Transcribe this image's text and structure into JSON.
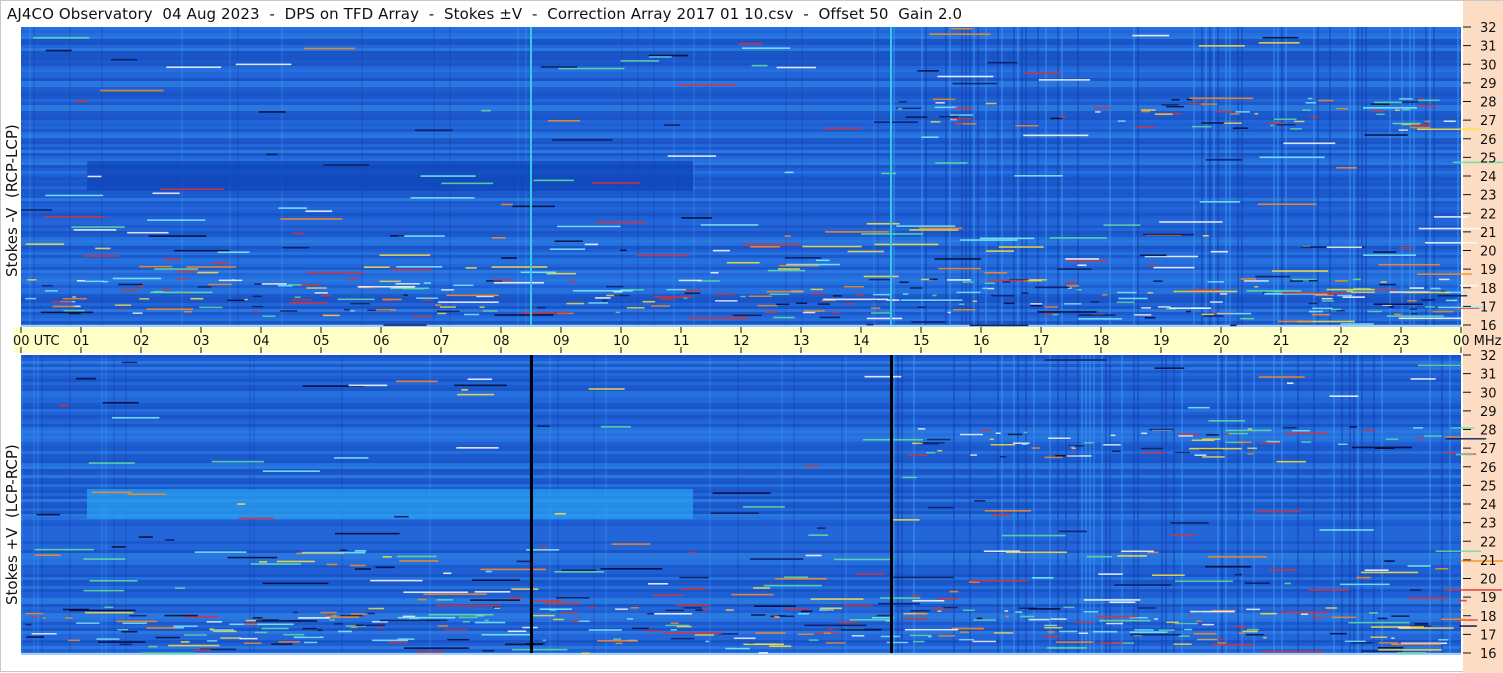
{
  "title": "AJ4CO Observatory  04 Aug 2023  -  DPS on TFD Array  -  Stokes ±V  -  Correction Array 2017 01 10.csv  -  Offset 50  Gain 2.0",
  "panels": [
    {
      "label": "Stokes -V  (RCP-LCP)"
    },
    {
      "label": "Stokes +V  (LCP-RCP)"
    }
  ],
  "time_axis": {
    "ticks": [
      "00 UTC",
      "01",
      "02",
      "03",
      "04",
      "05",
      "06",
      "07",
      "08",
      "09",
      "10",
      "11",
      "12",
      "13",
      "14",
      "15",
      "16",
      "17",
      "18",
      "19",
      "20",
      "21",
      "22",
      "23",
      "00 MHz"
    ]
  },
  "colors": {
    "background": "#1e5fd6",
    "dark_band": "#0f45b8",
    "bright_band": "#2a9ff0",
    "axis_band": "#ffffc8",
    "right_band": "#fddcc4"
  },
  "chart_data": {
    "type": "heatmap",
    "x_unit": "UTC hour",
    "y_unit": "MHz",
    "x_range": [
      0,
      24
    ],
    "y_range": [
      16,
      32
    ],
    "y_ticks": [
      16,
      17,
      18,
      19,
      20,
      21,
      22,
      23,
      24,
      25,
      26,
      27,
      28,
      29,
      30,
      31,
      32
    ],
    "panels": [
      "Stokes -V  (RCP-LCP)",
      "Stokes +V  (LCP-RCP)"
    ],
    "features": [
      {
        "type": "vline",
        "x": 8.5,
        "top_color": "#38c8e8",
        "bottom_color": "#000000"
      },
      {
        "type": "vline",
        "x": 14.5,
        "top_color": "#38c8e8",
        "bottom_color": "#000000"
      },
      {
        "type": "band",
        "x_start": 1.1,
        "x_end": 11.2,
        "y_low": 23.2,
        "y_high": 24.8,
        "top_color": "#0f45b8",
        "bottom_color": "#2a9ff0"
      },
      {
        "type": "noise_region",
        "x_start": 14.5,
        "x_end": 24,
        "y_low": 26.5,
        "y_high": 28.2
      },
      {
        "type": "noise_region",
        "x_start": 0,
        "x_end": 24,
        "y_low": 16.5,
        "y_high": 18.5
      }
    ]
  }
}
